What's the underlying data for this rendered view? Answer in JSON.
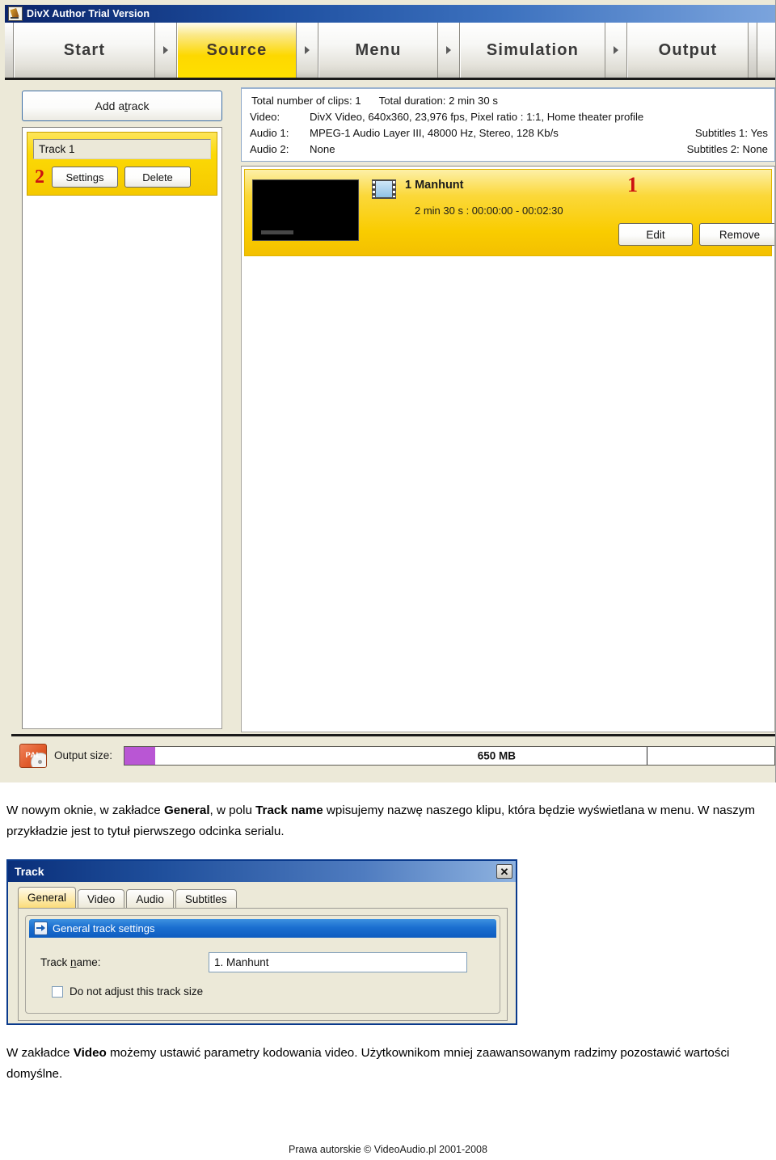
{
  "app": {
    "title": "DivX Author Trial Version",
    "title_icon": "divx-app-icon",
    "wizard_tabs": [
      {
        "label": "Start",
        "active": false
      },
      {
        "label": "Source",
        "active": true
      },
      {
        "label": "Menu",
        "active": false
      },
      {
        "label": "Simulation",
        "active": false
      },
      {
        "label": "Output",
        "active": false
      }
    ],
    "left_panel": {
      "add_track_label_pre": "Add a ",
      "add_track_label_underline": "t",
      "add_track_label_post": "rack",
      "track_name_value": "Track 1",
      "marker": "2",
      "settings_label": "Settings",
      "delete_label": "Delete"
    },
    "info": {
      "total_clips": "Total number of clips: 1",
      "total_duration": "Total duration: 2 min 30 s",
      "video_label": "Video:",
      "video_value": "DivX Video,  640x360,  23,976  fps,  Pixel ratio : 1:1,  Home theater profile",
      "audio1_label": "Audio 1:",
      "audio1_value": "MPEG-1 Audio Layer III,  48000  Hz,  Stereo,  128  Kb/s",
      "subtitles1": "Subtitles 1:  Yes",
      "audio2_label": "Audio 2:",
      "audio2_value": "None",
      "subtitles2": "Subtitles 2:  None"
    },
    "clip": {
      "title": "1 Manhunt",
      "time": "2 min 30 s :  00:00:00 - 00:02:30",
      "marker": "1",
      "edit_label": "Edit",
      "remove_label": "Remove",
      "thumbnail": "video-thumbnail-black",
      "film_icon": "film-strip-icon"
    },
    "output": {
      "standard_badge": "PAL",
      "label": "Output size:",
      "size_text": "650 MB",
      "fill_color": "#b956d4"
    }
  },
  "paragraph1": {
    "part1": "W nowym oknie, w zakładce ",
    "bold1": "General",
    "part2": ", w polu ",
    "bold2": "Track name",
    "part3": " wpisujemy nazwę naszego klipu, która będzie wyświetlana w menu. W naszym przykładzie jest to tytuł pierwszego odcinka serialu."
  },
  "dialog": {
    "title": "Track",
    "close_label": "✕",
    "tabs": [
      {
        "label": "General",
        "active": true
      },
      {
        "label": "Video",
        "active": false
      },
      {
        "label": "Audio",
        "active": false
      },
      {
        "label": "Subtitles",
        "active": false
      }
    ],
    "group_title": "General track settings",
    "track_name_label_pre": "Track ",
    "track_name_label_underline": "n",
    "track_name_label_post": "ame:",
    "track_name_value": "1. Manhunt",
    "checkbox_label": "Do not adjust this track size",
    "checkbox_checked": false
  },
  "paragraph2": {
    "part1": "W zakładce ",
    "bold1": "Video",
    "part2": " możemy ustawić parametry kodowania video. Użytkownikom mniej zaawansowanym radzimy pozostawić wartości domyślne."
  },
  "footer": {
    "copyright": "Prawa autorskie © VideoAudio.pl 2001-2008"
  }
}
